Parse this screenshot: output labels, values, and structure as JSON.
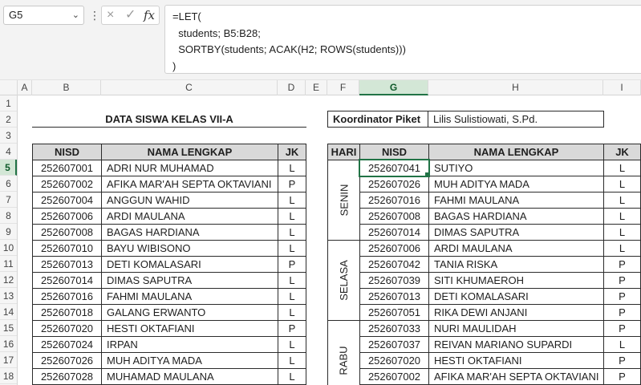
{
  "formula_bar": {
    "name_box": "G5",
    "cancel_icon": "×",
    "enter_icon": "✓",
    "fx_label": "fx",
    "formula": "=LET(\n  students; B5:B28;\n  SORTBY(students; ACAK(H2; ROWS(students)))\n)"
  },
  "columns": [
    "A",
    "B",
    "C",
    "D",
    "E",
    "F",
    "G",
    "H",
    "I"
  ],
  "rows": [
    "1",
    "2",
    "3",
    "4",
    "5",
    "6",
    "7",
    "8",
    "9",
    "10",
    "11",
    "12",
    "13",
    "14",
    "15",
    "16",
    "17",
    "18"
  ],
  "left_table": {
    "title": "DATA SISWA KELAS VII-A",
    "headers": [
      "NISD",
      "NAMA LENGKAP",
      "JK"
    ],
    "rows": [
      [
        "252607001",
        "ADRI NUR MUHAMAD",
        "L"
      ],
      [
        "252607002",
        "AFIKA MAR'AH SEPTA OKTAVIANI",
        "P"
      ],
      [
        "252607004",
        "ANGGUN WAHID",
        "L"
      ],
      [
        "252607006",
        "ARDI MAULANA",
        "L"
      ],
      [
        "252607008",
        "BAGAS HARDIANA",
        "L"
      ],
      [
        "252607010",
        "BAYU WIBISONO",
        "L"
      ],
      [
        "252607013",
        "DETI KOMALASARI",
        "P"
      ],
      [
        "252607014",
        "DIMAS SAPUTRA",
        "L"
      ],
      [
        "252607016",
        "FAHMI MAULANA",
        "L"
      ],
      [
        "252607018",
        "GALANG ERWANTO",
        "L"
      ],
      [
        "252607020",
        "HESTI OKTAFIANI",
        "P"
      ],
      [
        "252607024",
        "IRPAN",
        "L"
      ],
      [
        "252607026",
        "MUH ADITYA MADA",
        "L"
      ],
      [
        "252607028",
        "MUHAMAD MAULANA",
        "L"
      ]
    ]
  },
  "coordinator": {
    "label": "Koordinator Piket",
    "value": "Lilis Sulistiowati, S.Pd."
  },
  "right_table": {
    "headers": [
      "HARI",
      "NISD",
      "NAMA LENGKAP",
      "JK"
    ],
    "days": [
      "SENIN",
      "SELASA",
      "RABU"
    ],
    "rows": [
      [
        "252607041",
        "SUTIYO",
        "L"
      ],
      [
        "252607026",
        "MUH ADITYA MADA",
        "L"
      ],
      [
        "252607016",
        "FAHMI MAULANA",
        "L"
      ],
      [
        "252607008",
        "BAGAS HARDIANA",
        "L"
      ],
      [
        "252607014",
        "DIMAS SAPUTRA",
        "L"
      ],
      [
        "252607006",
        "ARDI MAULANA",
        "L"
      ],
      [
        "252607042",
        "TANIA RISKA",
        "P"
      ],
      [
        "252607039",
        "SITI KHUMAEROH",
        "P"
      ],
      [
        "252607013",
        "DETI KOMALASARI",
        "P"
      ],
      [
        "252607051",
        "RIKA DEWI ANJANI",
        "P"
      ],
      [
        "252607033",
        "NURI MAULIDAH",
        "P"
      ],
      [
        "252607037",
        "REIVAN MARIANO SUPARDI",
        "L"
      ],
      [
        "252607020",
        "HESTI OKTAFIANI",
        "P"
      ],
      [
        "252607002",
        "AFIKA MAR'AH SEPTA OKTAVIANI",
        "P"
      ]
    ]
  },
  "colors": {
    "accent": "#217346",
    "header_fill": "#d9d9d9"
  }
}
